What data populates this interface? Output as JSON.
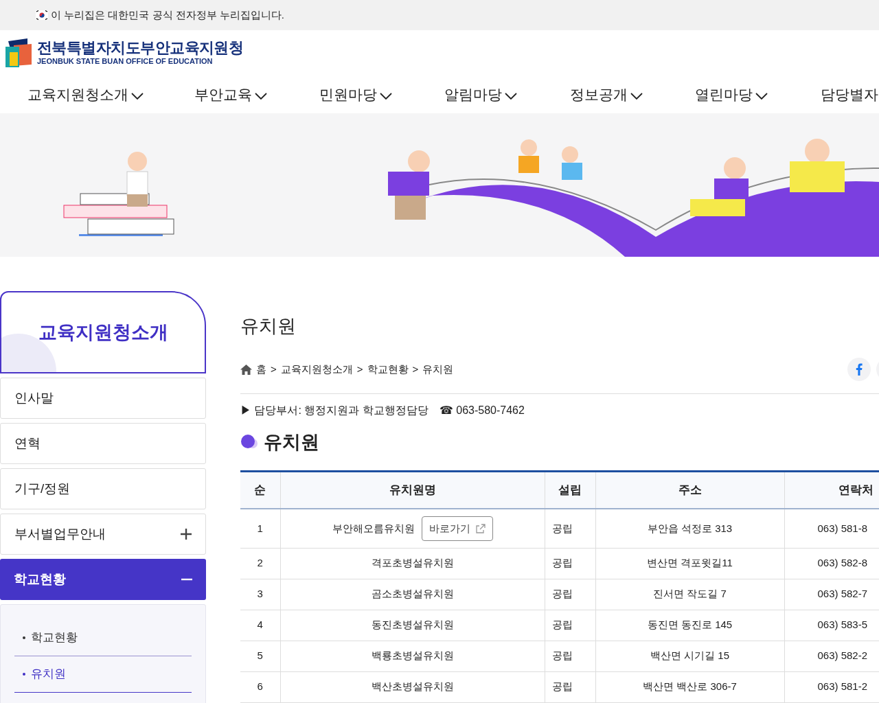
{
  "gov_banner": {
    "text": "이 누리집은 대한민국 공식 전자정부 누리집입니다."
  },
  "logo": {
    "title": "전북특별자치도부안교육지원청",
    "subtitle": "JEONBUK STATE BUAN OFFICE OF EDUCATION"
  },
  "nav": [
    {
      "label": "교육지원청소개"
    },
    {
      "label": "부안교육"
    },
    {
      "label": "민원마당"
    },
    {
      "label": "알림마당"
    },
    {
      "label": "정보공개"
    },
    {
      "label": "열린마당"
    },
    {
      "label": "담당별자"
    }
  ],
  "sidebar": {
    "title": "교육지원청소개",
    "items": [
      {
        "label": "인사말",
        "kind": "plain",
        "selected": false
      },
      {
        "label": "연혁",
        "kind": "plain",
        "selected": false
      },
      {
        "label": "기구/정원",
        "kind": "plain",
        "selected": false
      },
      {
        "label": "부서별업무안내",
        "kind": "expandable",
        "expanded": false,
        "selected": false
      },
      {
        "label": "학교현황",
        "kind": "expandable",
        "expanded": true,
        "selected": true
      }
    ],
    "submenu": [
      {
        "label": "학교현황",
        "selected": false
      },
      {
        "label": "유치원",
        "selected": true
      }
    ]
  },
  "page_title": "유치원",
  "breadcrumb": {
    "items": [
      "홈",
      "교육지원청소개",
      "학교현황",
      "유치원"
    ],
    "separator": ">"
  },
  "contact": {
    "department": "▶ 담당부서: 행정지원과 학교행정담당",
    "phone": "☎ 063-580-7462"
  },
  "section_title": "유치원",
  "table": {
    "columns": [
      "순",
      "유치원명",
      "설립",
      "주소",
      "연락처"
    ],
    "rows": [
      {
        "no": "1",
        "name": "부안해오름유치원",
        "link": "바로가기",
        "type": "공립",
        "address": "부안읍 석정로 313",
        "phone": "063) 581-8"
      },
      {
        "no": "2",
        "name": "격포초병설유치원",
        "type": "공립",
        "address": "변산면 격포윗길11",
        "phone": "063) 582-8"
      },
      {
        "no": "3",
        "name": "곰소초병설유치원",
        "type": "공립",
        "address": "진서면 작도길 7",
        "phone": "063) 582-7"
      },
      {
        "no": "4",
        "name": "동진초병설유치원",
        "type": "공립",
        "address": "동진면 동진로 145",
        "phone": "063) 583-5"
      },
      {
        "no": "5",
        "name": "백룡초병설유치원",
        "type": "공립",
        "address": "백산면 시기길 15",
        "phone": "063) 582-2"
      },
      {
        "no": "6",
        "name": "백산초병설유치원",
        "type": "공립",
        "address": "백산면 백산로 306-7",
        "phone": "063) 581-2"
      }
    ]
  }
}
